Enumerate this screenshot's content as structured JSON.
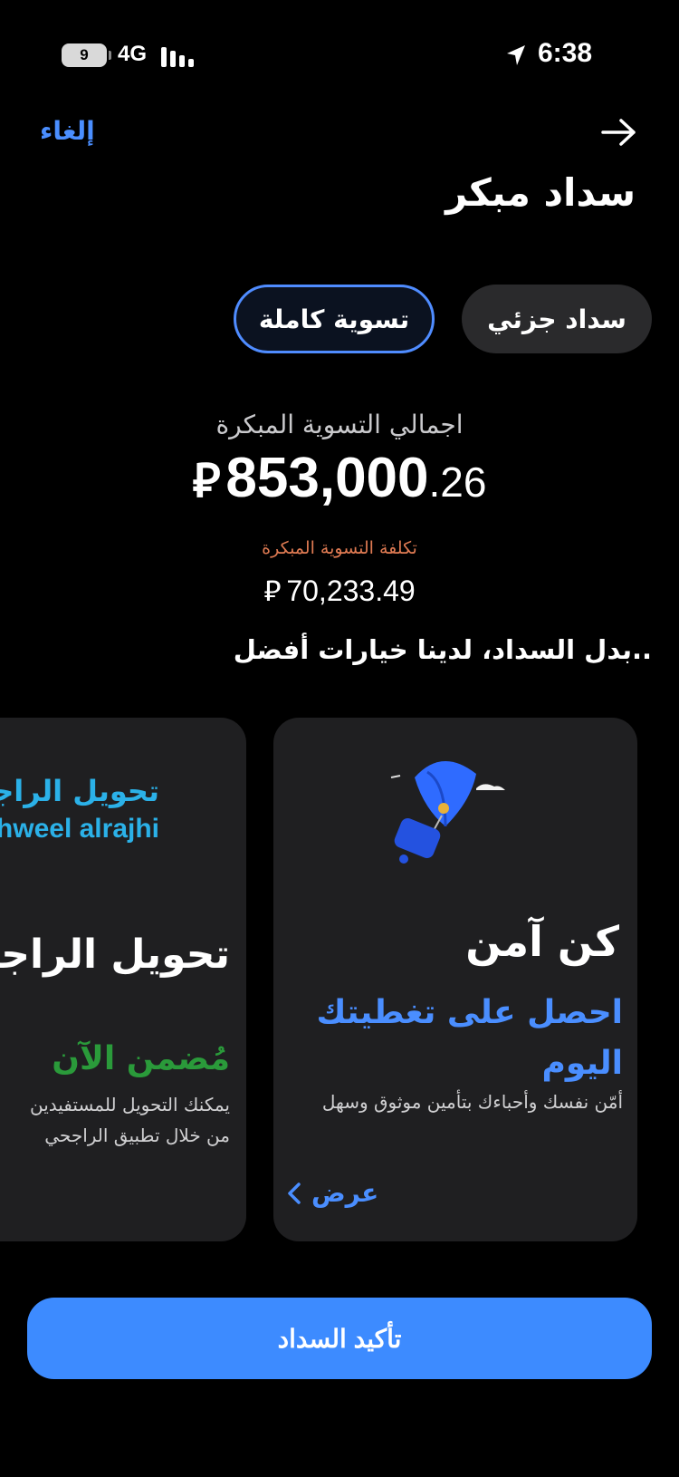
{
  "status_bar": {
    "battery": "9",
    "network": "4G",
    "time": "6:38"
  },
  "header": {
    "cancel_label": "إلغاء",
    "title": "سداد مبكر"
  },
  "tabs": [
    {
      "label": "سداد جزئي",
      "selected": false
    },
    {
      "label": "تسوية كاملة",
      "selected": true
    }
  ],
  "settlement": {
    "total_label": "اجمالي التسوية المبكرة",
    "total_whole": "853,000",
    "total_decimal": ".26",
    "currency_symbol": "⃁",
    "cost_label": "تكلفة التسوية المبكرة",
    "cost_amount": "70,233.49"
  },
  "options_heading": "..بدل السداد، لدينا خيارات أفضل",
  "cards": {
    "insurance": {
      "title": "كن آمن",
      "highlight": "احصل على تغطيتك اليوم",
      "description": "أمّن نفسك وأحباءك بتأمين موثوق وسهل",
      "view_label": "عرض"
    },
    "tahweel": {
      "logo_ar": "تحويل الراجحي",
      "logo_en": "tahweel alrajhi",
      "title": "تحويل الراجحي",
      "highlight": "مُضمن الآن",
      "description_line1": "يمكنك التحويل للمستفيدين",
      "description_line2": "من خلال تطبيق الراجحي"
    }
  },
  "confirm_label": "تأكيد السداد",
  "colors": {
    "accent": "#3d8bff",
    "link": "#4a8eff",
    "cost_label": "#e07b53",
    "success": "#2a9a3a",
    "card_bg": "#1f1f21"
  }
}
